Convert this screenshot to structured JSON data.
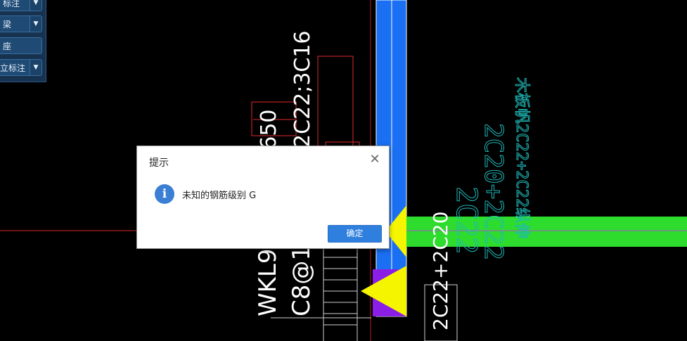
{
  "panel": {
    "items": [
      {
        "label": "标注",
        "has_dropdown": true
      },
      {
        "label": "梁",
        "has_dropdown": true
      },
      {
        "label": "座",
        "has_dropdown": false
      },
      {
        "label": "立标注",
        "has_dropdown": true
      }
    ]
  },
  "drawing": {
    "beam_label": "WKL9",
    "beam_size": "300*650",
    "stirrup": "C8@1",
    "top_bars": "2C22;3C16",
    "bottom_bars": "2C22+2C20",
    "bottom_bars_partial": "2C20",
    "bottom_bars_lower": "2C22",
    "cyan_text_1": "2C22",
    "cyan_text_2": "2C20+2C22",
    "cyan_text_top": "木板帆2C22+2C22纵伸",
    "colors": {
      "blue_column": "#1a6ff2",
      "green_beam": "#2ddc2d",
      "yellow": "#f5f500",
      "purple": "#8a1ee6",
      "cyan_text": "#1fb8b8",
      "red_line": "#e02a2a",
      "magenta": "#d92bd9"
    }
  },
  "dialog": {
    "title": "提示",
    "message": "未知的钢筋级别 G",
    "ok_label": "确定",
    "icon": "info-icon",
    "close_icon": "close-icon"
  }
}
